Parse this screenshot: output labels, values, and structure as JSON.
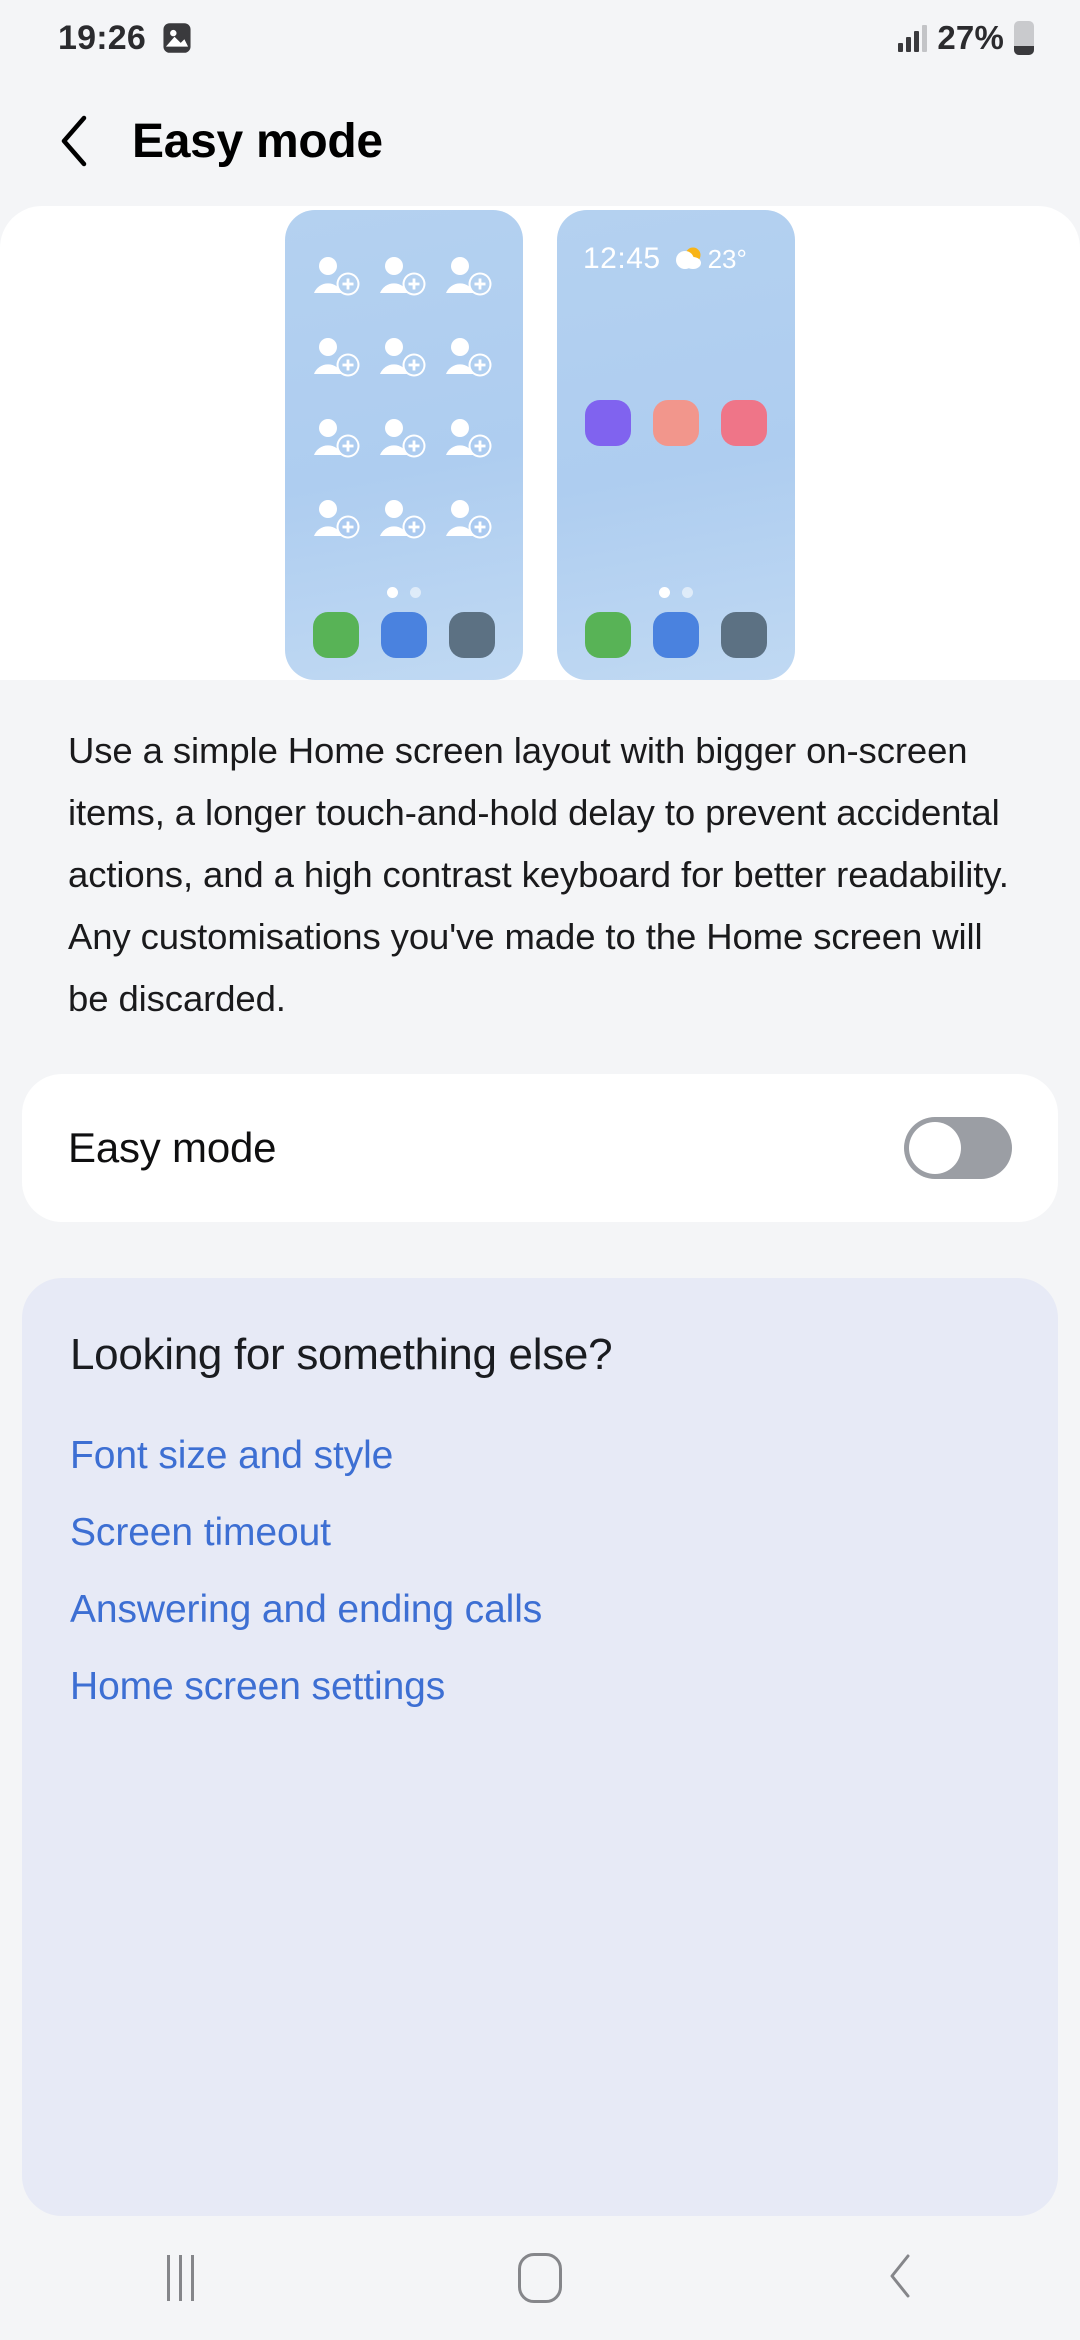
{
  "status_bar": {
    "time": "19:26",
    "gallery_icon": "image-icon",
    "signal_icon": "signal-bars-icon",
    "battery_percent": "27%",
    "battery_icon": "battery-icon"
  },
  "header": {
    "back_icon": "back-chevron-icon",
    "title": "Easy mode"
  },
  "illustration": {
    "left_phone": {
      "icon_name": "person-add-icon",
      "icon_rows": 4,
      "icon_cols": 3,
      "dock_colors": [
        "#58b356",
        "#4a82df",
        "#5c7183"
      ],
      "page_dots": 2
    },
    "right_phone": {
      "clock": "12:45",
      "weather_icon": "sun-behind-cloud-icon",
      "temperature": "23°",
      "app_colors": [
        "#8063ef",
        "#f2968c",
        "#ef7588"
      ],
      "dock_colors": [
        "#58b356",
        "#4a82df",
        "#5c7183"
      ],
      "page_dots": 2
    }
  },
  "description": "Use a simple Home screen layout with bigger on-screen items, a longer touch-and-hold delay to prevent accidental actions, and a high contrast keyboard for better readability. Any customisations you've made to the Home screen will be discarded.",
  "toggle_row": {
    "label": "Easy mode",
    "state": "off"
  },
  "looking_for": {
    "title": "Looking for something else?",
    "links": [
      "Font size and style",
      "Screen timeout",
      "Answering and ending calls",
      "Home screen settings"
    ]
  },
  "nav_bar": {
    "recents_icon": "recents-icon",
    "home_icon": "home-icon",
    "back_icon": "nav-back-icon"
  },
  "colors": {
    "page_background": "#f4f5f7",
    "card_white": "#ffffff",
    "looking_background": "#e7eaf6",
    "link_blue": "#3d6fd3",
    "switch_track_off": "#9b9ea4",
    "phone_blue": "#aecdf0"
  }
}
